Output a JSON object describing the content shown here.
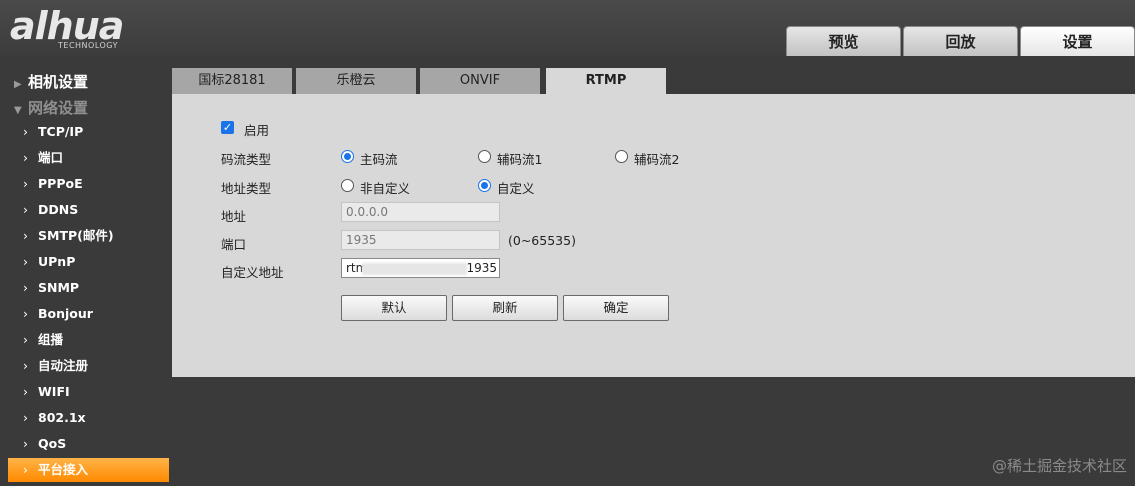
{
  "header": {
    "logo_text": "alhua",
    "logo_sub": "TECHNOLOGY",
    "tabs": [
      {
        "label": "预览",
        "active": false
      },
      {
        "label": "回放",
        "active": false
      },
      {
        "label": "设置",
        "active": true
      }
    ]
  },
  "sidebar": {
    "categories": [
      {
        "label": "相机设置",
        "expanded": false
      },
      {
        "label": "网络设置",
        "expanded": true
      }
    ],
    "items": [
      {
        "label": "TCP/IP"
      },
      {
        "label": "端口"
      },
      {
        "label": "PPPoE"
      },
      {
        "label": "DDNS"
      },
      {
        "label": "SMTP(邮件)"
      },
      {
        "label": "UPnP"
      },
      {
        "label": "SNMP"
      },
      {
        "label": "Bonjour"
      },
      {
        "label": "组播"
      },
      {
        "label": "自动注册"
      },
      {
        "label": "WIFI"
      },
      {
        "label": "802.1x"
      },
      {
        "label": "QoS"
      },
      {
        "label": "平台接入",
        "active": true
      }
    ]
  },
  "subtabs": [
    {
      "label": "国标28181"
    },
    {
      "label": "乐橙云"
    },
    {
      "label": "ONVIF"
    },
    {
      "label": "RTMP",
      "active": true
    }
  ],
  "form": {
    "enable_label": "启用",
    "enable_checked": true,
    "stream_type_label": "码流类型",
    "stream_options": [
      {
        "label": "主码流",
        "selected": true
      },
      {
        "label": "辅码流1",
        "selected": false
      },
      {
        "label": "辅码流2",
        "selected": false
      }
    ],
    "addr_type_label": "地址类型",
    "addr_options": [
      {
        "label": "非自定义",
        "selected": false
      },
      {
        "label": "自定义",
        "selected": true
      }
    ],
    "address_label": "地址",
    "address_value": "0.0.0.0",
    "port_label": "端口",
    "port_value": "1935",
    "port_range": "(0~65535)",
    "custom_addr_label": "自定义地址",
    "custom_addr_prefix": "rtm",
    "custom_addr_suffix": ":1935",
    "buttons": {
      "default": "默认",
      "refresh": "刷新",
      "confirm": "确定"
    }
  },
  "footer": {
    "watermark": "@稀土掘金技术社区"
  }
}
